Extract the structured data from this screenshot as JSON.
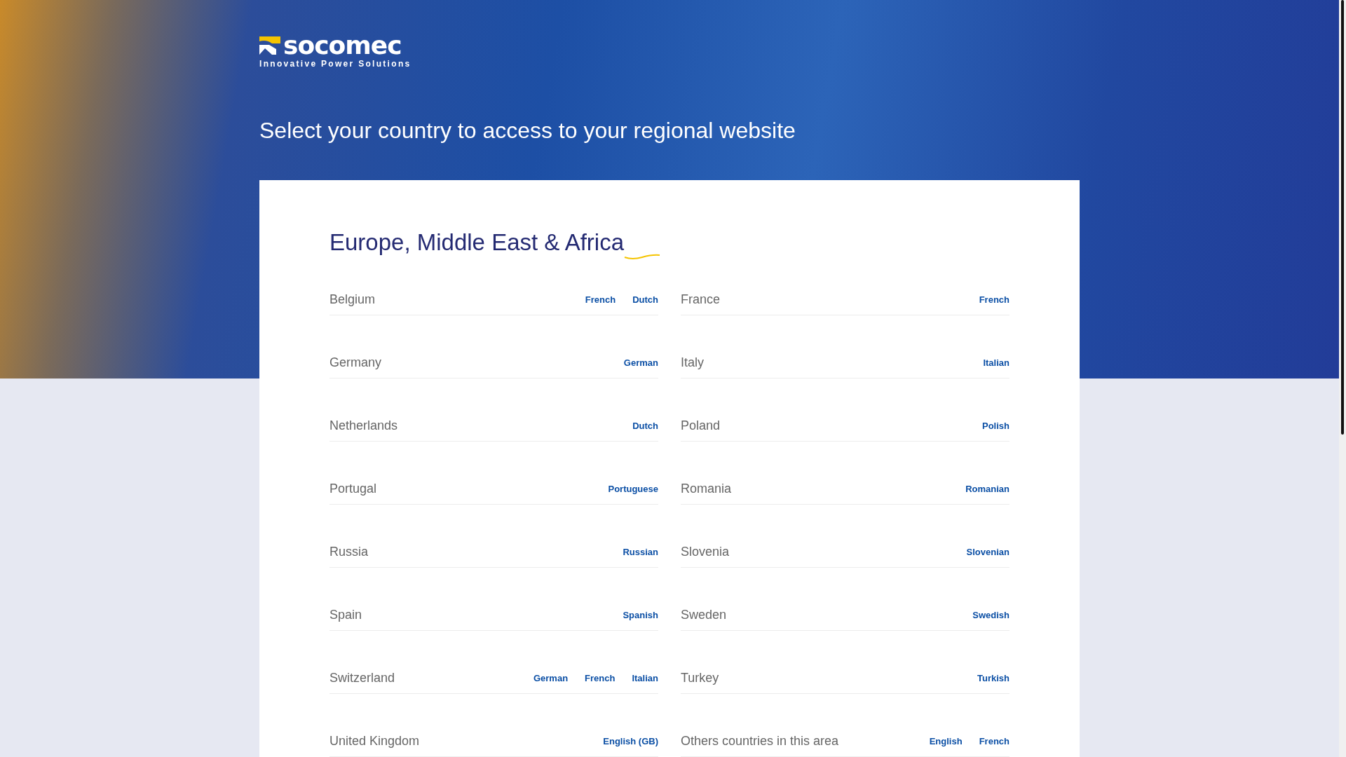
{
  "logo": {
    "name": "socomec",
    "tagline": "Innovative Power Solutions"
  },
  "headline": "Select your country to access to your regional website",
  "region": {
    "title": "Europe, Middle East & Africa",
    "countries": [
      {
        "name": "Belgium",
        "languages": [
          "French",
          "Dutch"
        ]
      },
      {
        "name": "France",
        "languages": [
          "French"
        ]
      },
      {
        "name": "Germany",
        "languages": [
          "German"
        ]
      },
      {
        "name": "Italy",
        "languages": [
          "Italian"
        ]
      },
      {
        "name": "Netherlands",
        "languages": [
          "Dutch"
        ]
      },
      {
        "name": "Poland",
        "languages": [
          "Polish"
        ]
      },
      {
        "name": "Portugal",
        "languages": [
          "Portuguese"
        ]
      },
      {
        "name": "Romania",
        "languages": [
          "Romanian"
        ]
      },
      {
        "name": "Russia",
        "languages": [
          "Russian"
        ]
      },
      {
        "name": "Slovenia",
        "languages": [
          "Slovenian"
        ]
      },
      {
        "name": "Spain",
        "languages": [
          "Spanish"
        ]
      },
      {
        "name": "Sweden",
        "languages": [
          "Swedish"
        ]
      },
      {
        "name": "Switzerland",
        "languages": [
          "German",
          "French",
          "Italian"
        ]
      },
      {
        "name": "Turkey",
        "languages": [
          "Turkish"
        ]
      },
      {
        "name": "United Kingdom",
        "languages": [
          "English (GB)"
        ]
      },
      {
        "name": "Others countries in this area",
        "languages": [
          "English",
          "French"
        ]
      }
    ]
  }
}
